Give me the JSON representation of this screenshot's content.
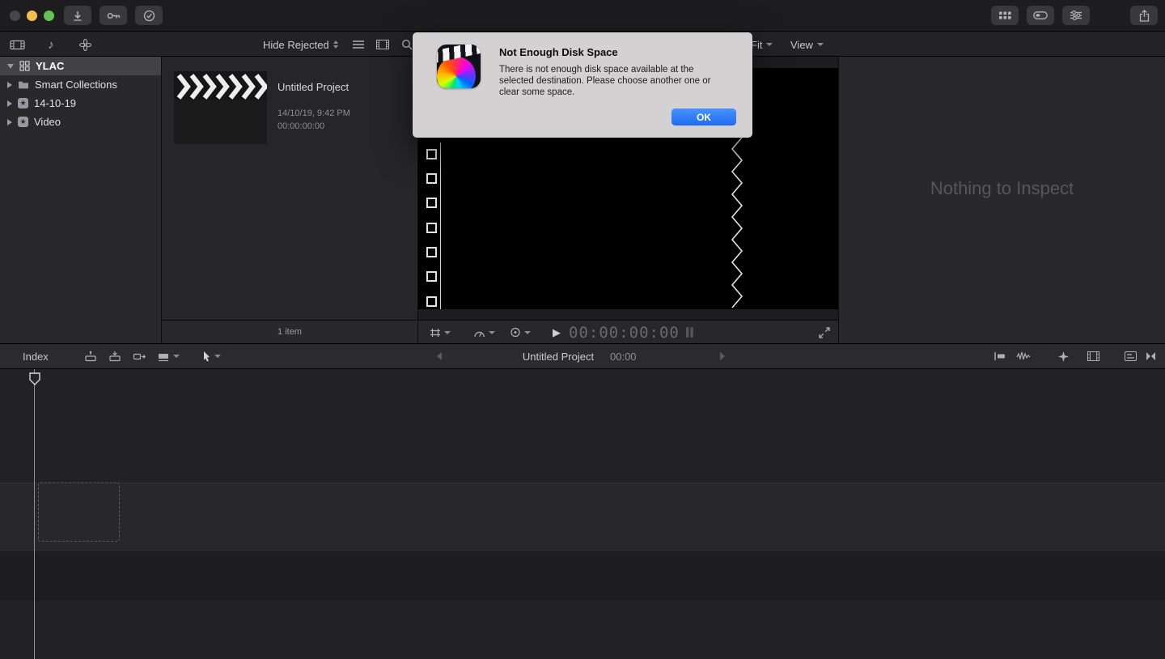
{
  "app": {
    "name": "Final Cut Pro"
  },
  "icons": {
    "star": "★",
    "music_note": "♪",
    "play": "▶"
  },
  "toolbar": {
    "filter_label": "Hide Rejected",
    "fit_label": "Fit",
    "view_label": "View"
  },
  "sidebar": {
    "library": {
      "label": "YLAC"
    },
    "items": [
      {
        "label": "Smart Collections"
      },
      {
        "label": "14-10-19"
      },
      {
        "label": "Video"
      }
    ]
  },
  "browser": {
    "clip": {
      "title": "Untitled Project",
      "date": "14/10/19, 9:42 PM",
      "duration": "00:00:00:00"
    },
    "status": "1 item"
  },
  "viewer": {
    "timecode": "00:00:00:00"
  },
  "inspector": {
    "empty_text": "Nothing to Inspect"
  },
  "dialog": {
    "title": "Not Enough Disk Space",
    "body": "There is not enough disk space available at the selected destination. Please choose another one or clear some space.",
    "ok_label": "OK"
  },
  "timeline": {
    "index_label": "Index",
    "project_name": "Untitled Project",
    "timecode": "00:00"
  },
  "colors": {
    "accent_blue": "#2d7cf7",
    "dialog_bg": "#d3d1d2"
  }
}
